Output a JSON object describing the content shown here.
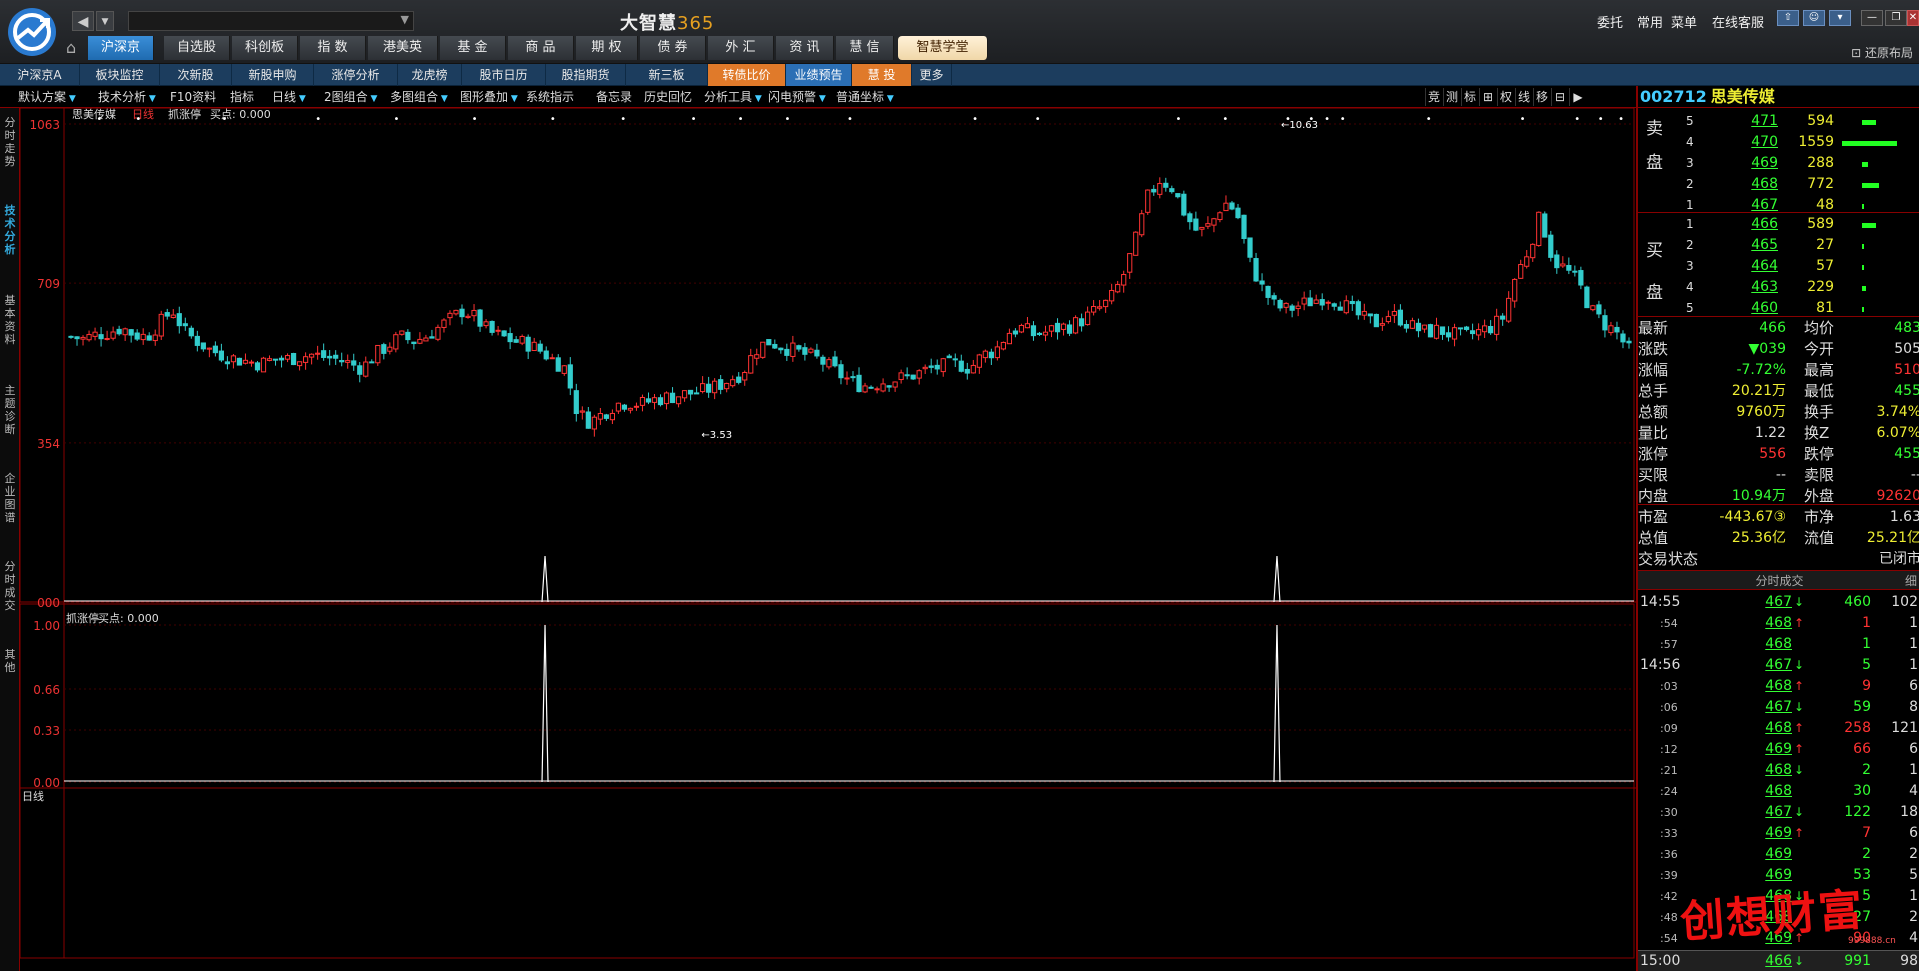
{
  "app": {
    "title_cn": "大智慧",
    "title_num": "365"
  },
  "top_menu": [
    "委托",
    "常用",
    "菜单",
    "在线客服"
  ],
  "restore_label": "还原布局",
  "nav_tabs": [
    "沪深京",
    "自选股",
    "科创板",
    "指 数",
    "港美英",
    "基 金",
    "商 品",
    "期 权",
    "债 券",
    "外 汇",
    "资 讯",
    "慧 信"
  ],
  "nav_highlight": "智慧学堂",
  "sub_tabs": [
    "沪深京A",
    "板块监控",
    "次新股",
    "新股申购",
    "涨停分析",
    "龙虎榜",
    "股市日历",
    "股指期货",
    "新三板",
    "转债比价",
    "业绩预告",
    "慧 投",
    "更多"
  ],
  "toolbar": [
    "默认方案",
    "技术分析",
    "F10资料",
    "指标",
    "日线",
    "2图组合",
    "多图组合",
    "图形叠加",
    "系统指示",
    "备忘录",
    "历史回忆",
    "分析工具",
    "闪电预警",
    "普通坐标"
  ],
  "toolbar_right": [
    "竞",
    "测",
    "标",
    "⊞",
    "权",
    "线",
    "移",
    "⊟",
    "▶"
  ],
  "side_tabs": [
    "分时走势",
    "技术分析",
    "基本资料",
    "主题诊断",
    "企业图谱",
    "分时成交",
    "其他"
  ],
  "chart_labels": {
    "name": "思美传媒",
    "period": "日线",
    "indicator": "抓涨停",
    "buy": "买点: 0.000",
    "sub_indicator": "抓涨停",
    "sub_buy": "买点: 0.000",
    "high_mark": "10.63",
    "low_mark": "3.53",
    "bottom_tab": "日线"
  },
  "chart_data": {
    "type": "candlestick",
    "price_axis": [
      {
        "label": "1063",
        "value": 10.63
      },
      {
        "label": "709",
        "value": 7.09
      },
      {
        "label": "354",
        "value": 3.54
      },
      {
        "label": "000",
        "value": 0
      }
    ],
    "sub_axis": [
      "1.00",
      "0.66",
      "0.33",
      "0.00"
    ],
    "high": 10.63,
    "low": 3.53,
    "signal_positions": [
      0.305,
      0.773
    ],
    "ylim": [
      3.53,
      10.63
    ],
    "path": [
      5.9,
      5.85,
      5.95,
      6.0,
      6.1,
      5.95,
      5.9,
      6.2,
      6.5,
      6.0,
      5.8,
      5.6,
      5.5,
      5.4,
      5.35,
      5.3,
      5.4,
      5.4,
      5.45,
      5.5,
      5.45,
      5.4,
      5.3,
      5.2,
      5.5,
      5.7,
      5.9,
      5.8,
      5.9,
      6.1,
      6.3,
      6.5,
      6.3,
      6.0,
      5.9,
      5.8,
      5.75,
      5.6,
      5.4,
      5.2,
      4.2,
      4.0,
      4.2,
      4.4,
      4.45,
      4.4,
      4.5,
      4.55,
      4.6,
      4.65,
      4.7,
      4.8,
      4.95,
      5.1,
      5.6,
      5.8,
      5.7,
      5.6,
      5.5,
      5.4,
      5.2,
      5.0,
      4.85,
      4.8,
      4.9,
      4.95,
      5.0,
      5.1,
      5.2,
      5.25,
      5.3,
      5.2,
      5.5,
      5.6,
      6.0,
      6.1,
      5.95,
      6.0,
      6.1,
      6.15,
      6.3,
      6.5,
      6.7,
      7.2,
      8.0,
      9.0,
      9.4,
      9.2,
      8.6,
      8.2,
      8.4,
      8.9,
      8.7,
      7.6,
      7.0,
      6.6,
      6.5,
      6.6,
      6.7,
      6.8,
      6.7,
      6.5,
      6.3,
      6.2,
      6.4,
      6.3,
      6.1,
      6.0,
      6.05,
      5.95,
      5.9,
      6.0,
      6.1,
      6.3,
      7.2,
      7.8,
      8.6,
      7.6,
      7.4,
      7.1,
      6.5,
      6.2,
      6.0,
      5.6
    ]
  },
  "stock": {
    "code": "002712",
    "name": "思美传媒"
  },
  "orderbook": {
    "sell_label": [
      "卖",
      "盘"
    ],
    "buy_label": [
      "买",
      "盘"
    ],
    "sell": [
      {
        "lv": "5",
        "price": "471",
        "vol": "594",
        "bar": 0.25
      },
      {
        "lv": "4",
        "price": "470",
        "vol": "1559",
        "bar": 1.0
      },
      {
        "lv": "3",
        "price": "469",
        "vol": "288",
        "bar": 0.1
      },
      {
        "lv": "2",
        "price": "468",
        "vol": "772",
        "bar": 0.3
      },
      {
        "lv": "1",
        "price": "467",
        "vol": "48",
        "bar": 0.02
      }
    ],
    "buy": [
      {
        "lv": "1",
        "price": "466",
        "vol": "589",
        "bar": 0.25
      },
      {
        "lv": "2",
        "price": "465",
        "vol": "27",
        "bar": 0.01
      },
      {
        "lv": "3",
        "price": "464",
        "vol": "57",
        "bar": 0.02
      },
      {
        "lv": "4",
        "price": "463",
        "vol": "229",
        "bar": 0.08
      },
      {
        "lv": "5",
        "price": "460",
        "vol": "81",
        "bar": 0.03
      }
    ]
  },
  "quote": [
    {
      "l1": "最新",
      "v1": "466",
      "c1": "g",
      "l2": "均价",
      "v2": "483",
      "c2": "g"
    },
    {
      "l1": "涨跌",
      "v1": "▼039",
      "c1": "g",
      "l2": "今开",
      "v2": "505",
      "c2": "w"
    },
    {
      "l1": "涨幅",
      "v1": "-7.72%",
      "c1": "g",
      "l2": "最高",
      "v2": "510",
      "c2": "r"
    },
    {
      "l1": "总手",
      "v1": "20.21万",
      "c1": "y",
      "l2": "最低",
      "v2": "455",
      "c2": "g"
    },
    {
      "l1": "总额",
      "v1": "9760万",
      "c1": "y",
      "l2": "换手",
      "v2": "3.74%",
      "c2": "y"
    },
    {
      "l1": "量比",
      "v1": "1.22",
      "c1": "w",
      "l2": "换Z",
      "v2": "6.07%",
      "c2": "y"
    },
    {
      "l1": "涨停",
      "v1": "556",
      "c1": "r",
      "l2": "跌停",
      "v2": "455",
      "c2": "g"
    },
    {
      "l1": "买限",
      "v1": "--",
      "c1": "w",
      "l2": "卖限",
      "v2": "--",
      "c2": "w"
    },
    {
      "l1": "内盘",
      "v1": "10.94万",
      "c1": "g",
      "l2": "外盘",
      "v2": "92620",
      "c2": "r"
    },
    {
      "l1": "市盈",
      "v1": "-443.67③",
      "c1": "y",
      "l2": "市净",
      "v2": "1.63",
      "c2": "w"
    },
    {
      "l1": "总值",
      "v1": "25.36亿",
      "c1": "y",
      "l2": "流值",
      "v2": "25.21亿",
      "c2": "y"
    },
    {
      "l1": "交易状态",
      "v1": "",
      "c1": "w",
      "l2": "",
      "v2": "已闭市",
      "c2": "w"
    }
  ],
  "ticks_header": "分时成交",
  "ticks_header_right": "细",
  "ticks": [
    {
      "t": "14:55",
      "sub": false,
      "p": "467",
      "c": "g",
      "a": "↓",
      "ac": "g",
      "v": "460",
      "vc": "g",
      "n": "102"
    },
    {
      "t": ":54",
      "sub": true,
      "p": "468",
      "c": "g",
      "a": "↑",
      "ac": "r",
      "v": "1",
      "vc": "r",
      "n": "1"
    },
    {
      "t": ":57",
      "sub": true,
      "p": "468",
      "c": "g",
      "a": "",
      "ac": "w",
      "v": "1",
      "vc": "g",
      "n": "1"
    },
    {
      "t": "14:56",
      "sub": false,
      "p": "467",
      "c": "g",
      "a": "↓",
      "ac": "g",
      "v": "5",
      "vc": "g",
      "n": "1"
    },
    {
      "t": ":03",
      "sub": true,
      "p": "468",
      "c": "g",
      "a": "↑",
      "ac": "r",
      "v": "9",
      "vc": "r",
      "n": "6"
    },
    {
      "t": ":06",
      "sub": true,
      "p": "467",
      "c": "g",
      "a": "↓",
      "ac": "g",
      "v": "59",
      "vc": "g",
      "n": "8"
    },
    {
      "t": ":09",
      "sub": true,
      "p": "468",
      "c": "g",
      "a": "↑",
      "ac": "r",
      "v": "258",
      "vc": "r",
      "n": "121"
    },
    {
      "t": ":12",
      "sub": true,
      "p": "469",
      "c": "g",
      "a": "↑",
      "ac": "r",
      "v": "66",
      "vc": "r",
      "n": "6"
    },
    {
      "t": ":21",
      "sub": true,
      "p": "468",
      "c": "g",
      "a": "↓",
      "ac": "g",
      "v": "2",
      "vc": "g",
      "n": "1"
    },
    {
      "t": ":24",
      "sub": true,
      "p": "468",
      "c": "g",
      "a": "",
      "ac": "w",
      "v": "30",
      "vc": "g",
      "n": "4"
    },
    {
      "t": ":30",
      "sub": true,
      "p": "467",
      "c": "g",
      "a": "↓",
      "ac": "g",
      "v": "122",
      "vc": "g",
      "n": "18"
    },
    {
      "t": ":33",
      "sub": true,
      "p": "469",
      "c": "g",
      "a": "↑",
      "ac": "r",
      "v": "7",
      "vc": "r",
      "n": "6"
    },
    {
      "t": ":36",
      "sub": true,
      "p": "469",
      "c": "g",
      "a": "",
      "ac": "w",
      "v": "2",
      "vc": "g",
      "n": "2"
    },
    {
      "t": ":39",
      "sub": true,
      "p": "469",
      "c": "g",
      "a": "",
      "ac": "w",
      "v": "53",
      "vc": "g",
      "n": "5"
    },
    {
      "t": ":42",
      "sub": true,
      "p": "468",
      "c": "g",
      "a": "↓",
      "ac": "g",
      "v": "5",
      "vc": "g",
      "n": "1"
    },
    {
      "t": ":48",
      "sub": true,
      "p": "468",
      "c": "g",
      "a": "",
      "ac": "w",
      "v": "27",
      "vc": "g",
      "n": "2"
    },
    {
      "t": ":54",
      "sub": true,
      "p": "469",
      "c": "g",
      "a": "↑",
      "ac": "r",
      "v": "90",
      "vc": "r",
      "n": "4"
    }
  ],
  "last_tick": {
    "t": "15:00",
    "p": "466",
    "v": "991",
    "n": "98"
  },
  "watermark": "创想财富",
  "watermark_url": "999888.cn"
}
